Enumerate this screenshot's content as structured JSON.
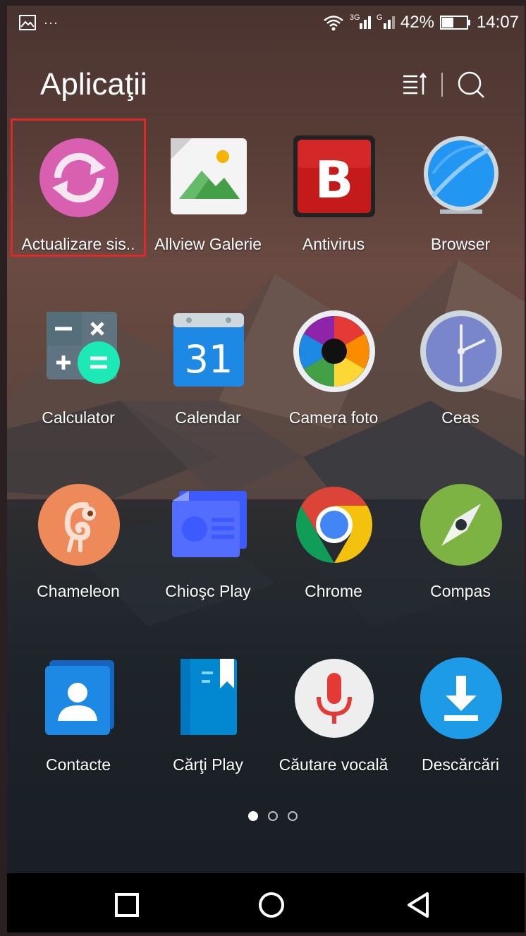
{
  "status_bar": {
    "left_icons": [
      "image-notification-icon",
      "more-icon"
    ],
    "more_text": "···",
    "network_1": "3G",
    "network_2": "G",
    "battery_percent": "42%",
    "time": "14:07"
  },
  "header": {
    "title": "Aplicaţii",
    "sort_icon": "sort-icon",
    "search_icon": "search-icon"
  },
  "apps": [
    {
      "label": "Actualizare sis..",
      "icon": "system-update-icon",
      "highlighted": true
    },
    {
      "label": "Allview Galerie",
      "icon": "gallery-icon"
    },
    {
      "label": "Antivirus",
      "icon": "antivirus-icon"
    },
    {
      "label": "Browser",
      "icon": "browser-icon"
    },
    {
      "label": "Calculator",
      "icon": "calculator-icon"
    },
    {
      "label": "Calendar",
      "icon": "calendar-icon",
      "icon_text": "31"
    },
    {
      "label": "Camera foto",
      "icon": "camera-icon"
    },
    {
      "label": "Ceas",
      "icon": "clock-icon"
    },
    {
      "label": "Chameleon",
      "icon": "chameleon-icon"
    },
    {
      "label": "Chioşc Play",
      "icon": "play-kiosk-icon"
    },
    {
      "label": "Chrome",
      "icon": "chrome-icon"
    },
    {
      "label": "Compas",
      "icon": "compass-icon"
    },
    {
      "label": "Contacte",
      "icon": "contacts-icon"
    },
    {
      "label": "Cărţi Play",
      "icon": "play-books-icon"
    },
    {
      "label": "Căutare vocală",
      "icon": "voice-search-icon"
    },
    {
      "label": "Descărcări",
      "icon": "downloads-icon"
    }
  ],
  "antivirus_letter": "B",
  "page_indicator": {
    "pages": 3,
    "current": 1
  },
  "nav_bar": [
    "recents-icon",
    "home-icon",
    "back-icon"
  ],
  "colors": {
    "highlight_border": "#e02828",
    "update_icon": "#d95fb0",
    "chameleon": "#ee8a5a",
    "downloads": "#1e9be6"
  }
}
